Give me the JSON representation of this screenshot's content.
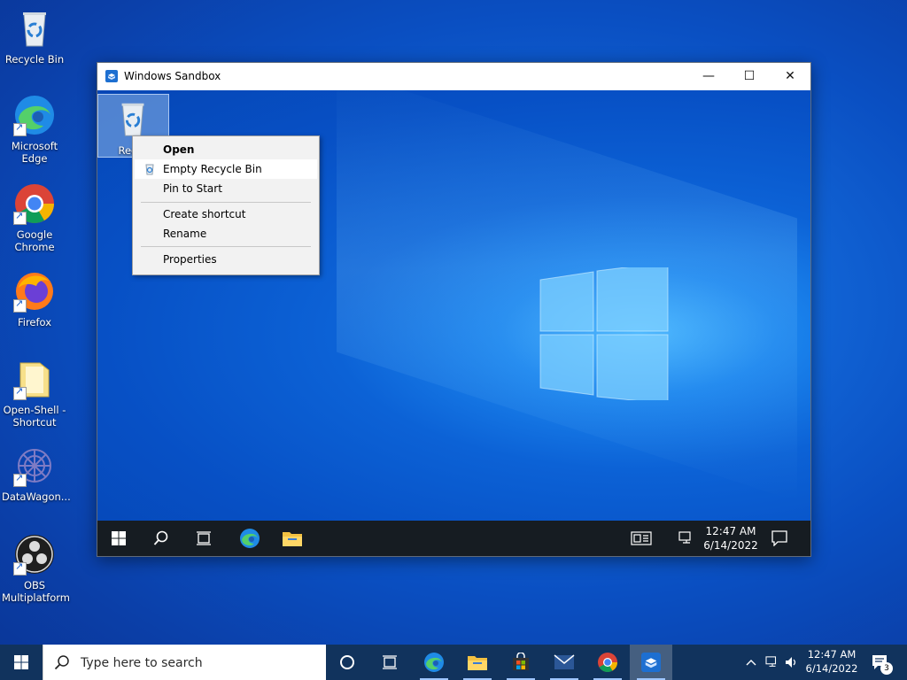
{
  "desktop": {
    "icons": [
      {
        "label": "Recycle Bin"
      },
      {
        "label": "Microsoft Edge"
      },
      {
        "label": "Google Chrome"
      },
      {
        "label": "Firefox"
      },
      {
        "label": "Open-Shell - Shortcut"
      },
      {
        "label": "DataWagon..."
      },
      {
        "label": "OBS Multiplatform"
      }
    ]
  },
  "sandbox": {
    "title": "Windows Sandbox",
    "controls": {
      "minimize": "—",
      "maximize": "☐",
      "close": "✕"
    },
    "desktop_icon_label": "Recyc",
    "context_menu": {
      "items": [
        {
          "label": "Open",
          "bold": true
        },
        {
          "label": "Empty Recycle Bin",
          "highlighted": true
        },
        {
          "label": "Pin to Start"
        },
        {
          "label": "Create shortcut"
        },
        {
          "label": "Rename"
        },
        {
          "label": "Properties"
        }
      ]
    },
    "taskbar": {
      "time": "12:47 AM",
      "date": "6/14/2022"
    }
  },
  "taskbar": {
    "search_placeholder": "Type here to search",
    "time": "12:47 AM",
    "date": "6/14/2022",
    "notification_count": "3"
  },
  "colors": {
    "desktop_blue": "#0b4fc2",
    "taskbar": "#11335d",
    "inner_taskbar": "#161c22",
    "menu_bg": "#f2f2f2"
  }
}
